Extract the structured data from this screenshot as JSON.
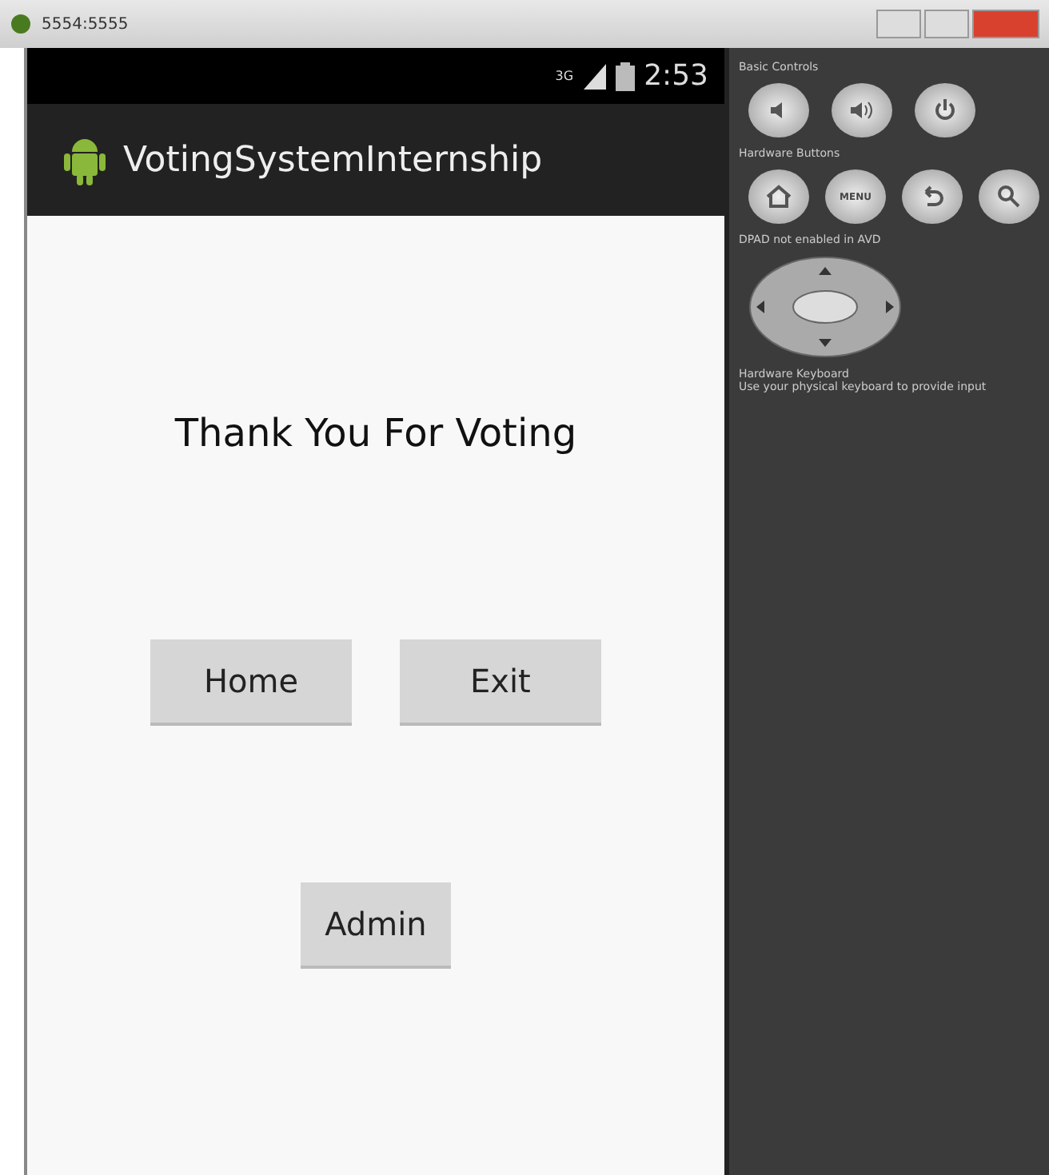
{
  "window": {
    "title": "5554:5555"
  },
  "status_bar": {
    "network": "3G",
    "time": "2:53"
  },
  "action_bar": {
    "title": "VotingSystemInternship"
  },
  "content": {
    "message": "Thank You For Voting",
    "buttons": [
      {
        "label": "Home"
      },
      {
        "label": "Exit"
      },
      {
        "label": "Admin"
      }
    ]
  },
  "controls": {
    "basic_title": "Basic Controls",
    "hardware_title": "Hardware Buttons",
    "menu_label": "MENU",
    "dpad_note": "DPAD not enabled in AVD",
    "keyboard_title": "Hardware Keyboard",
    "keyboard_note": "Use your physical keyboard to provide input"
  }
}
